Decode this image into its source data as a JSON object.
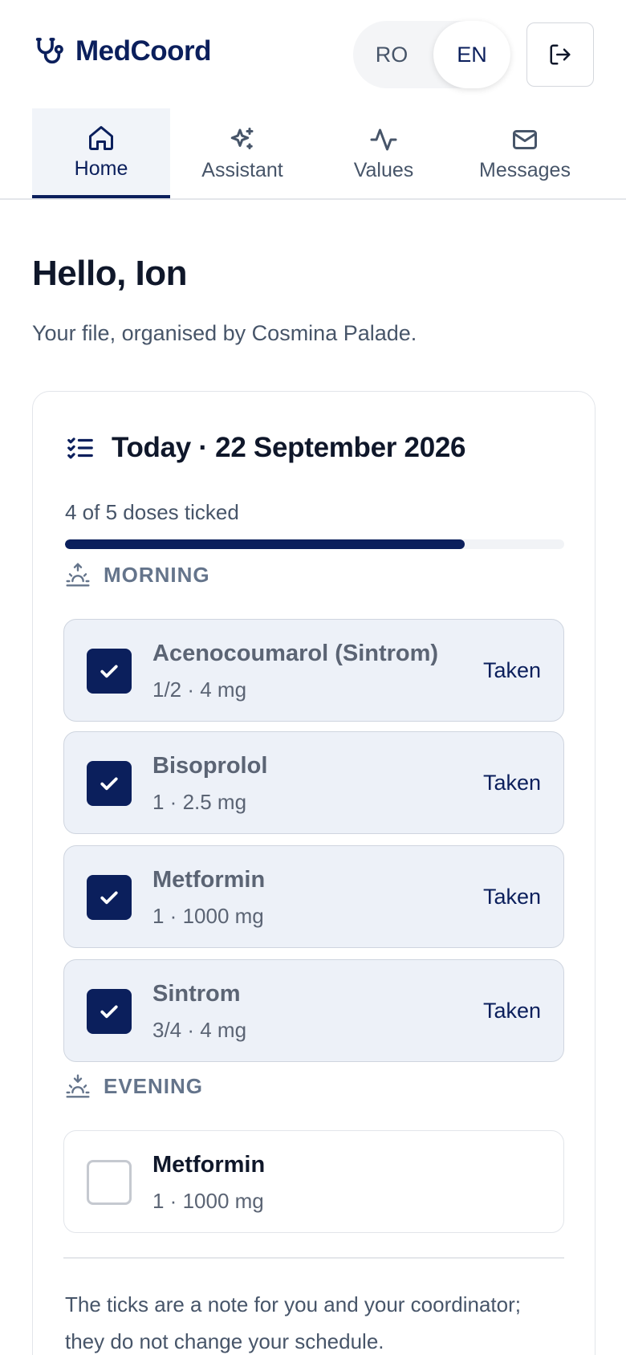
{
  "app": {
    "name": "MedCoord",
    "languages": {
      "ro": "RO",
      "en": "EN",
      "selected": "EN"
    }
  },
  "nav": {
    "tabs": [
      {
        "label": "Home",
        "icon": "home-icon",
        "active": true
      },
      {
        "label": "Assistant",
        "icon": "sparkles-icon",
        "active": false
      },
      {
        "label": "Values",
        "icon": "activity-icon",
        "active": false
      },
      {
        "label": "Messages",
        "icon": "mail-icon",
        "active": false
      }
    ]
  },
  "main": {
    "greeting": "Hello, Ion",
    "subtitle": "Your file, organised by Cosmina Palade."
  },
  "today": {
    "title": "Today · 22 September 2026",
    "progress_text": "4 of 5 doses ticked",
    "progress_fraction": 0.8,
    "morning": {
      "label": "MORNING",
      "doses": [
        {
          "name": "Acenocoumarol (Sintrom)",
          "detail": "1/2 · 4 mg",
          "status": "Taken",
          "checked": true
        },
        {
          "name": "Bisoprolol",
          "detail": "1 · 2.5 mg",
          "status": "Taken",
          "checked": true
        },
        {
          "name": "Metformin",
          "detail": "1 · 1000 mg",
          "status": "Taken",
          "checked": true
        },
        {
          "name": "Sintrom",
          "detail": "3/4 · 4 mg",
          "status": "Taken",
          "checked": true
        }
      ]
    },
    "evening": {
      "label": "EVENING",
      "doses": [
        {
          "name": "Metformin",
          "detail": "1 · 1000 mg",
          "checked": false
        }
      ]
    },
    "footnote": "The ticks are a note for you and your coordinator; they do not change your schedule."
  },
  "colors": {
    "primary": "#0b1f5c",
    "taken_background": "#edf1f8",
    "muted_text": "#475569"
  }
}
